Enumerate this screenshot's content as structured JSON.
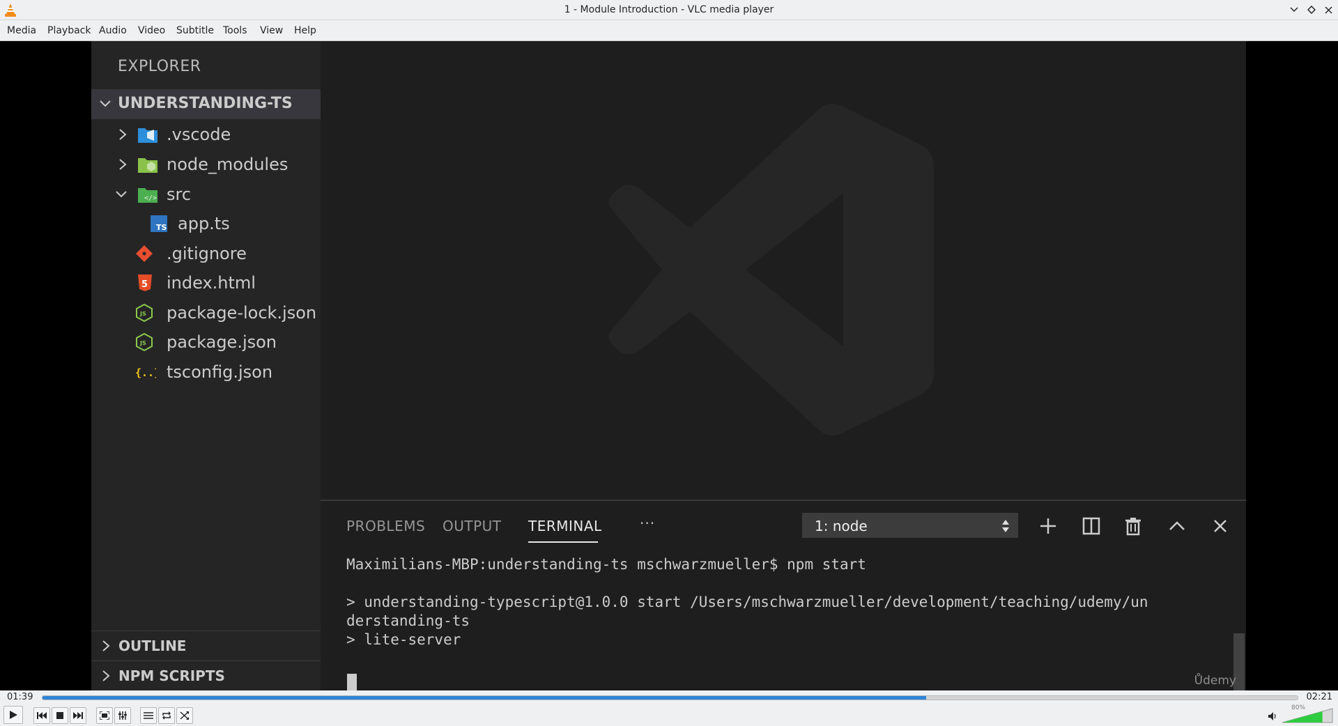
{
  "window": {
    "title": "1 - Module Introduction - VLC media player"
  },
  "menu": {
    "items": [
      "Media",
      "Playback",
      "Audio",
      "Video",
      "Subtitle",
      "Tools",
      "View",
      "Help"
    ]
  },
  "video_content": {
    "explorer": {
      "title": "EXPLORER",
      "project": "UNDERSTANDING-TS",
      "items": [
        {
          "name": ".vscode",
          "icon": "vscode-folder-icon"
        },
        {
          "name": "node_modules",
          "icon": "node-folder-icon"
        },
        {
          "name": "src",
          "icon": "src-folder-icon"
        },
        {
          "name": "app.ts",
          "icon": "typescript-file-icon"
        },
        {
          "name": ".gitignore",
          "icon": "git-file-icon"
        },
        {
          "name": "index.html",
          "icon": "html-file-icon"
        },
        {
          "name": "package-lock.json",
          "icon": "nodejs-file-icon"
        },
        {
          "name": "package.json",
          "icon": "nodejs-file-icon"
        },
        {
          "name": "tsconfig.json",
          "icon": "json-file-icon"
        }
      ],
      "outline": "OUTLINE",
      "npm_scripts": "NPM SCRIPTS"
    },
    "panel": {
      "tabs": [
        "PROBLEMS",
        "OUTPUT",
        "TERMINAL"
      ],
      "active_tab": "TERMINAL",
      "more": "···",
      "terminal_select": "1: node",
      "terminal_lines": [
        "Maximilians-MBP:understanding-ts mschwarzmueller$ npm start",
        "",
        "> understanding-typescript@1.0.0 start /Users/mschwarzmueller/development/teaching/udemy/un",
        "derstanding-ts",
        "> lite-server"
      ],
      "watermark": "Ůdemy"
    }
  },
  "player": {
    "elapsed": "01:39",
    "total": "02:21",
    "progress": 0.704,
    "volume_label": "80%",
    "volume": 0.8,
    "accent_color": "#2f86d6"
  }
}
